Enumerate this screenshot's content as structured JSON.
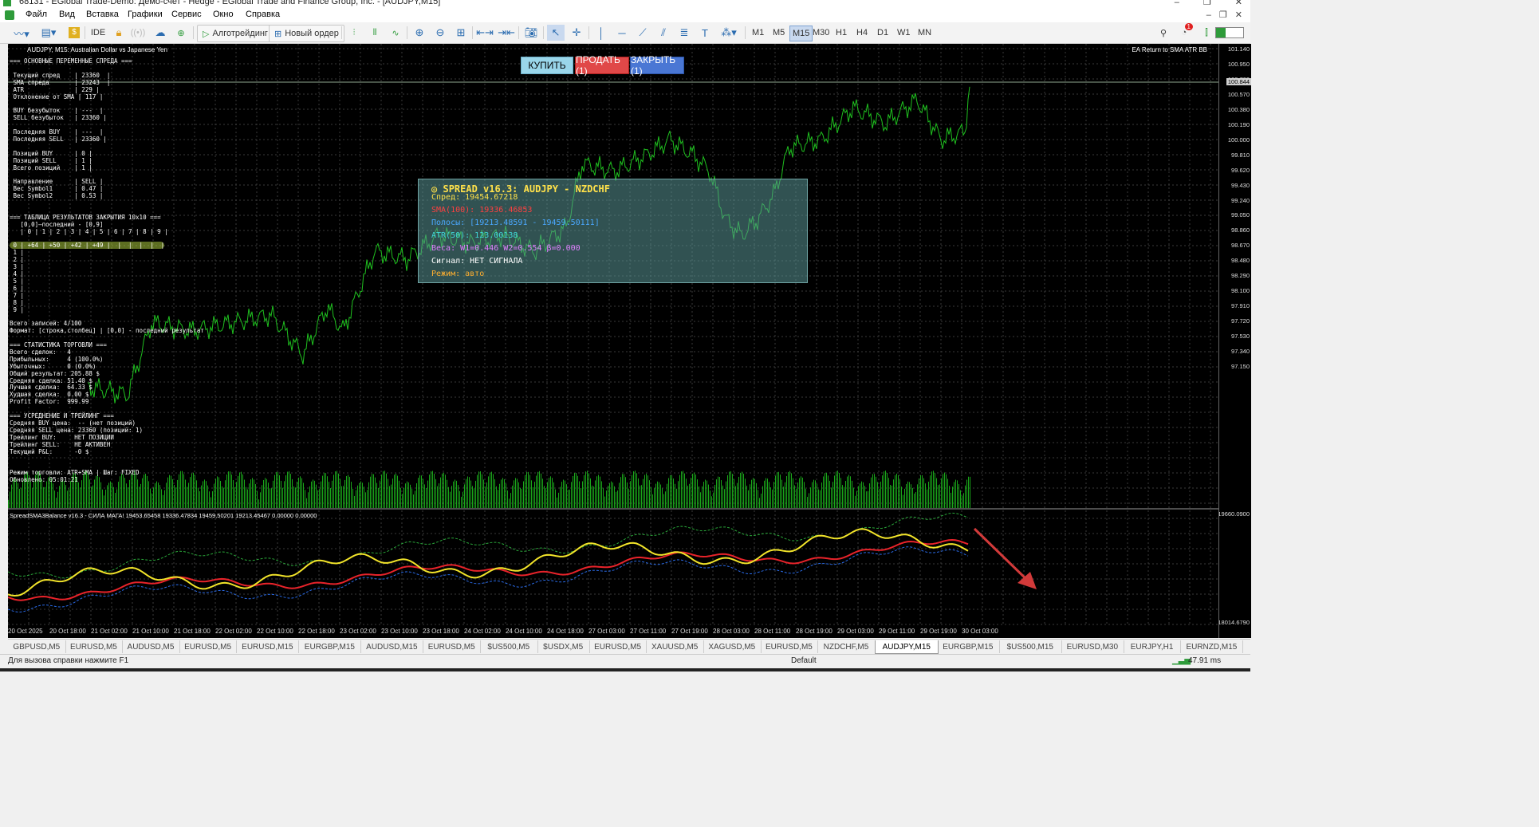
{
  "window": {
    "title": "68131 - EGlobal Trade-Demo: Демо-счет - Hedge - EGlobal Trade and Finance Group, Inc. - [AUDJPY,M15]"
  },
  "menu": [
    "Файл",
    "Вид",
    "Вставка",
    "Графики",
    "Сервис",
    "Окно",
    "Справка"
  ],
  "toolbar": {
    "ide_label": "IDE",
    "algo_label": "Алготрейдинг",
    "new_order_label": "Новый ордер",
    "timeframes": [
      "M1",
      "M5",
      "M15",
      "M30",
      "H1",
      "H4",
      "D1",
      "W1",
      "MN"
    ],
    "active_timeframe": "M15",
    "notification_count": "1"
  },
  "chart": {
    "symbol_title": "AUDJPY, M15:  Australian Dollar vs Japanese Yen",
    "ea_label": "EA Return to SMA ATR BB",
    "buy_label": "КУПИТЬ",
    "sell_label": "ПРОДАТЬ (1)",
    "close_label": "ЗАКРЫТЬ (1)",
    "current_price": "100.844",
    "price_levels": [
      "101.140",
      "100.950",
      "100.760",
      "100.570",
      "100.380",
      "100.190",
      "100.000",
      "99.810",
      "99.620",
      "99.430",
      "99.240",
      "99.050",
      "98.860",
      "98.670",
      "98.480",
      "98.290",
      "98.100",
      "97.910",
      "97.720",
      "97.530",
      "97.340",
      "97.150"
    ],
    "indicator_levels": [
      "19660.0900",
      "18014.6790"
    ],
    "indicator_label": "SpreadSMA3Balance v16.3 - СИЛА МАГА! 19453.65458 19336.47834 19459.50201 19213.45467 0.00000 0.00000",
    "time_labels": [
      "20 Oct 2025",
      "20 Oct 18:00",
      "21 Oct 02:00",
      "21 Oct 10:00",
      "21 Oct 18:00",
      "22 Oct 02:00",
      "22 Oct 10:00",
      "22 Oct 18:00",
      "23 Oct 02:00",
      "23 Oct 10:00",
      "23 Oct 18:00",
      "24 Oct 02:00",
      "24 Oct 10:00",
      "24 Oct 18:00",
      "27 Oct 03:00",
      "27 Oct 11:00",
      "27 Oct 19:00",
      "28 Oct 03:00",
      "28 Oct 11:00",
      "28 Oct 19:00",
      "29 Oct 03:00",
      "29 Oct 11:00",
      "29 Oct 19:00",
      "30 Oct 03:00"
    ],
    "left_panel_lines": [
      "=== ОСНОВНЫЕ ПЕРЕМЕННЫЕ СПРЕДА ===",
      "",
      " Текущий спред    | 23360  |",
      " SMA спреда       | 23243  |",
      " ATR              | 229 |",
      " Отклонение от SMA | 117 |",
      "",
      " BUY безубыток    | ---  |",
      " SELL безубыток   | 23360 |",
      "",
      " Последняя BUY    | ---  |",
      " Последняя SELL   | 23360 |",
      "",
      " Позиций BUY      | 0 |",
      " Позиций SELL     | 1 |",
      " Всего позиций    | 1 |",
      "",
      " Направление      | SELL |",
      " Вес Symbol1      | 0.47 |",
      " Вес Symbol2      | 0.53 |",
      "",
      "",
      "=== ТАБЛИЦА РЕЗУЛЬТАТОВ ЗАКРЫТИЯ 10x10 ===",
      "   [0,0]—последний - [0,9]",
      "   | 0 | 1 | 2 | 3 | 4 | 5 | 6 | 7 | 8 | 9 |",
      "",
      " 0 | +64 | +50 | +42 | +49 |  |  |  |  |  |",
      " 1 |",
      " 2 |",
      " 3 |",
      " 4 |",
      " 5 |",
      " 6 |",
      " 7 |",
      " 8 |",
      " 9 |",
      "",
      "Всего записей: 4/100",
      "Формат: [строка,столбец] | [0,0] - последний результат",
      "",
      "=== СТАТИСТИКА ТОРГОВЛИ ===",
      "Всего сделок:   4",
      "Прибыльных:     4 (100.0%)",
      "Убыточных:      0 (0.0%)",
      "Общий результат: 205.88 $",
      "Средняя сделка: 51.40 $",
      "Лучшая сделка:  64.33 $",
      "Худшая сделка:  0.00 $",
      "Profit Factor:  999.99",
      "",
      "=== УСРЕДНЕНИЕ И ТРЕЙЛИНГ ===",
      "Средняя BUY цена:  -- (нет позиций)",
      "Средняя SELL цена: 23360 (позиций: 1)",
      "Трейлинг BUY:     НЕТ ПОЗИЦИИ",
      "Трейлинг SELL:    НЕ АКТИВЕН",
      "Текущий P&L:      -0 $",
      "",
      "",
      "Режим торговли: ATR+SMA | Шаг: FIXED",
      "Обновлено: 05:01:21"
    ],
    "spread_panel": {
      "title": "SPREAD v16.3: AUDJPY - NZDCHF",
      "spread": "Спред: 19454.67218",
      "sma": "SMA(100): 19336.46853",
      "bands": "Полосы: [19213.48591 - 19459.50111]",
      "atr": "ATR(50): 123.00138",
      "weights": "Веса: W1=0.446 W2=0.554 β=0.000",
      "signal": "Сигнал: НЕТ СИГНАЛА",
      "mode": "Режим: авто"
    }
  },
  "tabs": [
    "GBPUSD,M5",
    "EURUSD,M5",
    "AUDUSD,M5",
    "EURUSD,M5",
    "EURUSD,M15",
    "EURGBP,M15",
    "AUDUSD,M15",
    "EURUSD,M5",
    "$US500,M5",
    "$USDX,M5",
    "EURUSD,M5",
    "XAUUSD,M5",
    "XAGUSD,M5",
    "EURUSD,M5",
    "NZDCHF,M5",
    "AUDJPY,M15",
    "EURGBP,M15",
    "$US500,M15",
    "EURUSD,M30",
    "EURJPY,H1",
    "EURNZD,M15"
  ],
  "active_tab": "AUDJPY,M15",
  "status": {
    "help": "Для вызова справки нажмите F1",
    "profile": "Default",
    "ping": "47.91 ms"
  },
  "colors": {
    "price_line": "#1fc01f",
    "indicator_yellow": "#f2e42a",
    "indicator_red": "#e8232a",
    "indicator_blue": "#2a6be8",
    "panel_header": "#ffe14a"
  }
}
